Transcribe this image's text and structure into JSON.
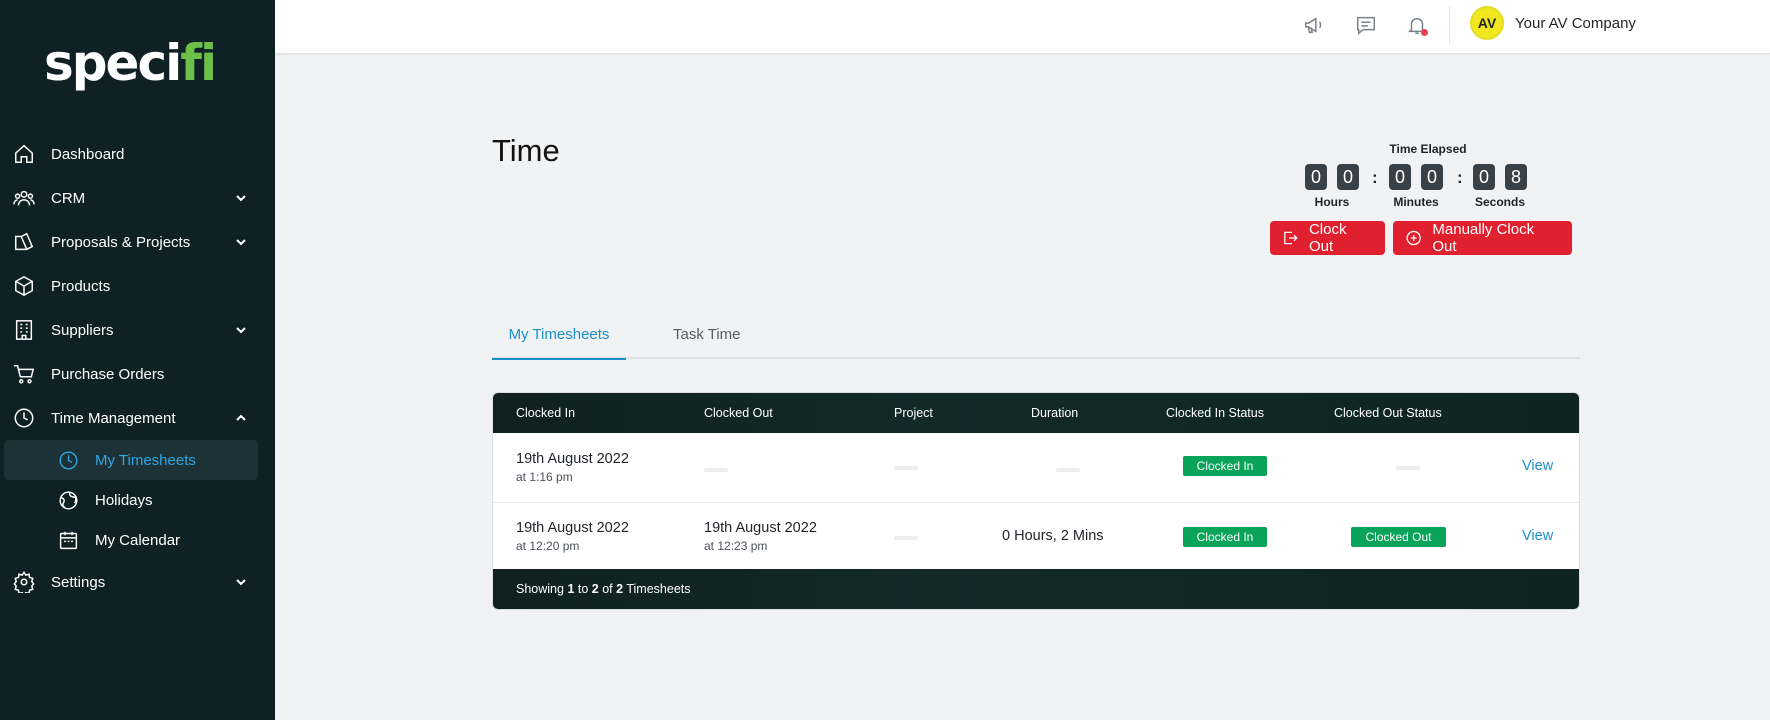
{
  "brand": {
    "logo_main": "speci",
    "logo_accent": "fi"
  },
  "sidebar": {
    "items": [
      {
        "label": "Dashboard",
        "icon": "home-icon"
      },
      {
        "label": "CRM",
        "icon": "users-icon"
      },
      {
        "label": "Proposals & Projects",
        "icon": "proposals-icon"
      },
      {
        "label": "Products",
        "icon": "box-icon"
      },
      {
        "label": "Suppliers",
        "icon": "building-icon"
      },
      {
        "label": "Purchase Orders",
        "icon": "cart-icon"
      },
      {
        "label": "Time Management",
        "icon": "clock-icon"
      },
      {
        "label": "Settings",
        "icon": "gear-icon"
      }
    ],
    "sub_items": [
      {
        "label": "My Timesheets",
        "icon": "clock-icon",
        "active": true
      },
      {
        "label": "Holidays",
        "icon": "globe-icon"
      },
      {
        "label": "My Calendar",
        "icon": "calendar-icon"
      }
    ]
  },
  "topbar": {
    "icons": [
      "megaphone-icon",
      "chat-icon",
      "bell-icon"
    ],
    "avatar_initials": "AV",
    "company": "Your AV Company"
  },
  "page": {
    "title": "Time"
  },
  "timer": {
    "label": "Time Elapsed",
    "hours": [
      "0",
      "0"
    ],
    "minutes": [
      "0",
      "0"
    ],
    "seconds": [
      "0",
      "8"
    ],
    "units": {
      "hours": "Hours",
      "minutes": "Minutes",
      "seconds": "Seconds"
    },
    "separator": ":"
  },
  "actions": {
    "clock_out": "Clock Out",
    "manual_clock_out": "Manually Clock Out"
  },
  "tabs": [
    {
      "label": "My Timesheets",
      "active": true
    },
    {
      "label": "Task Time",
      "active": false
    }
  ],
  "table": {
    "headers": [
      "Clocked In",
      "Clocked Out",
      "Project",
      "Duration",
      "Clocked In Status",
      "Clocked Out Status"
    ],
    "rows": [
      {
        "clocked_in_date": "19th August 2022",
        "clocked_in_time": "at 1:16 pm",
        "clocked_out_date": "",
        "clocked_out_time": "",
        "project": "",
        "duration": "",
        "in_status": "Clocked In",
        "out_status": "",
        "action": "View"
      },
      {
        "clocked_in_date": "19th August 2022",
        "clocked_in_time": "at 12:20 pm",
        "clocked_out_date": "19th August 2022",
        "clocked_out_time": "at 12:23 pm",
        "project": "",
        "duration": "0 Hours, 2 Mins",
        "in_status": "Clocked In",
        "out_status": "Clocked Out",
        "action": "View"
      }
    ],
    "footer": {
      "prefix": "Showing",
      "from": "1",
      "to_word": "to",
      "to": "2",
      "of_word": "of",
      "total": "2",
      "suffix": "Timesheets"
    }
  },
  "colors": {
    "sidebar_bg": "#0f2125",
    "accent": "#1a8fc8",
    "danger": "#e0202e",
    "success": "#0aa35a",
    "avatar": "#f1e71f",
    "logo_accent": "#6cc04a"
  }
}
